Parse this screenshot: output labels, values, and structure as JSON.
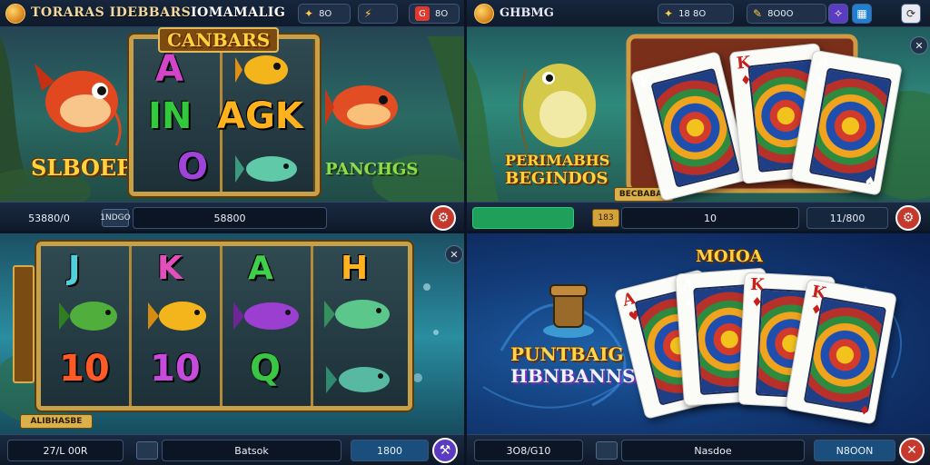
{
  "q1": {
    "brand": "TORARAS IDEBBARS",
    "title": "IOMAMALIG",
    "pill_a": "8O",
    "pill_b": "8O",
    "reel_title": "CANBARS",
    "symbols": [
      "A",
      "IN",
      "AGK",
      "O"
    ],
    "left_label": "SLBOEP",
    "right_label": "PANCHGS",
    "bottom_left": "53880/0",
    "bottom_tag": "1NDGO",
    "bottom_value": "58800"
  },
  "q2": {
    "brand": "GHBMG",
    "pill_a": "18 8O",
    "pill_b": "8O0O",
    "title_line1": "PERIMABHS",
    "title_line2": "BEGINDOS",
    "sub_tag": "BECBABAR",
    "bottom_tag": "183",
    "bottom_value": "10",
    "bottom_right": "11/800",
    "cards": [
      {
        "rank": "K",
        "suit": "♠"
      },
      {
        "rank": "K",
        "suit": "♦"
      },
      {
        "rank": "A",
        "suit": "♠"
      }
    ]
  },
  "q3": {
    "symbols_top": [
      "J",
      "K",
      "A",
      "H"
    ],
    "symbols_bottom": [
      "10",
      "10",
      "Q"
    ],
    "side_label": "",
    "bottom_badge": "ALIBHASBE",
    "bottom_left": "27/L 00R",
    "bottom_value": "Batsok",
    "bottom_right": "1800"
  },
  "q4": {
    "title_top": "MOIOA",
    "title_line1": "PUNTBAIG",
    "title_line2": "HBNBANNS",
    "bottom_left": "3O8/G10",
    "bottom_value": "Nasdoe",
    "bottom_right": "N8OON",
    "cards": [
      {
        "rank": "A",
        "suit": "♥"
      },
      {
        "rank": "A",
        "suit": "♠"
      },
      {
        "rank": "K",
        "suit": "♦"
      },
      {
        "rank": "K",
        "suit": "♦"
      }
    ]
  },
  "colors": {
    "gold": "#ffd33d",
    "frame": "#c9a04a",
    "danger": "#e03a2f",
    "accent_green": "#1ea05a",
    "accent_purple": "#5b3bbf"
  }
}
